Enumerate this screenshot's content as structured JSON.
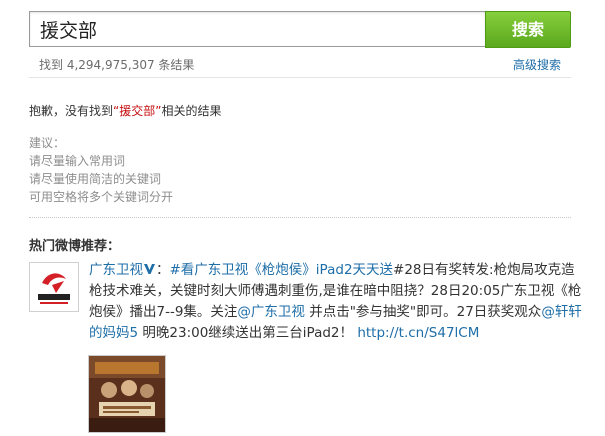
{
  "search": {
    "query": "援交部",
    "button_label": "搜索"
  },
  "result_count": "找到 4,294,975,307 条结果",
  "advanced_search": "高级搜索",
  "no_result": {
    "prefix": "抱歉，没有找到",
    "keyword": "“援交部”",
    "suffix": "相关的结果"
  },
  "suggestions": {
    "heading": "建议：",
    "items": [
      "请尽量输入常用词",
      "请尽量使用简洁的关键词",
      "可用空格将多个关键词分开"
    ]
  },
  "hot_section_title": "热门微博推荐：",
  "post": {
    "author": "广东卫视",
    "verified_icon": "verified-v-icon",
    "colon": "：",
    "topic": "#看广东卫视《枪炮侯》iPad2天天送",
    "text_1": "#28日有奖转发:枪炮局攻克造枪技术难关，关键时刻大师傅遇刺重伤,是谁在暗中阻挠？28日20:05广东卫视《枪炮侯》播出7--9集。关注",
    "mention_1": "@广东卫视",
    "text_2": " 并点击\"参与抽奖\"即可。27日获奖观众",
    "mention_2": "@轩轩的妈妈5",
    "text_3": " 明晚23:00继续送出第三台iPad2！ ",
    "link": "http://t.cn/S47lCM"
  },
  "colors": {
    "accent_green": "#6fbd2a",
    "link_blue": "#1e6ea8",
    "keyword_red": "#c50e0e"
  },
  "avatar_icon": "guangdong-tv-logo-icon",
  "thumbnail_icon": "post-image-thumbnail"
}
